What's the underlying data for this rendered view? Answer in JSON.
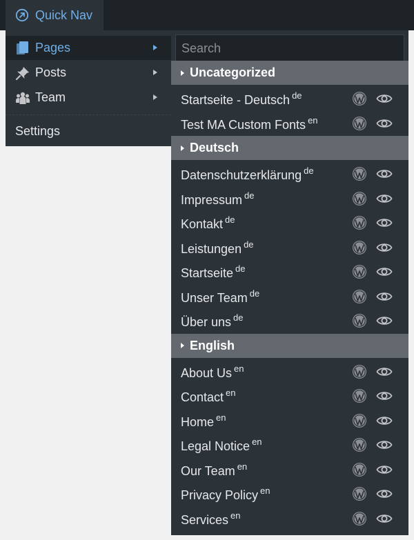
{
  "adminbar": {
    "quicknav_label": "Quick Nav",
    "quicknav_icon": "arrow-circle-icon"
  },
  "menu": {
    "items": [
      {
        "label": "Pages",
        "icon": "pages-icon",
        "active": true
      },
      {
        "label": "Posts",
        "icon": "pin-icon",
        "active": false
      },
      {
        "label": "Team",
        "icon": "team-icon",
        "active": false
      }
    ],
    "settings_label": "Settings"
  },
  "panel": {
    "search_placeholder": "Search",
    "groups": [
      {
        "name": "Uncategorized",
        "items": [
          {
            "title": "Startseite - Deutsch",
            "lang": "de"
          },
          {
            "title": "Test MA Custom Fonts",
            "lang": "en"
          }
        ]
      },
      {
        "name": "Deutsch",
        "items": [
          {
            "title": "Datenschutzerklärung",
            "lang": "de"
          },
          {
            "title": "Impressum",
            "lang": "de"
          },
          {
            "title": "Kontakt",
            "lang": "de"
          },
          {
            "title": "Leistungen",
            "lang": "de"
          },
          {
            "title": "Startseite",
            "lang": "de"
          },
          {
            "title": "Unser Team",
            "lang": "de"
          },
          {
            "title": "Über uns",
            "lang": "de"
          }
        ]
      },
      {
        "name": "English",
        "items": [
          {
            "title": "About Us",
            "lang": "en"
          },
          {
            "title": "Contact",
            "lang": "en"
          },
          {
            "title": "Home",
            "lang": "en"
          },
          {
            "title": "Legal Notice",
            "lang": "en"
          },
          {
            "title": "Our Team",
            "lang": "en"
          },
          {
            "title": "Privacy Policy",
            "lang": "en"
          },
          {
            "title": "Services",
            "lang": "en"
          }
        ]
      }
    ]
  },
  "colors": {
    "accent": "#72aee6",
    "adminbar_bg": "#1d2327",
    "menu_bg": "#2c3338",
    "group_header_bg": "#646970",
    "icon_color": "#8c8f94"
  }
}
